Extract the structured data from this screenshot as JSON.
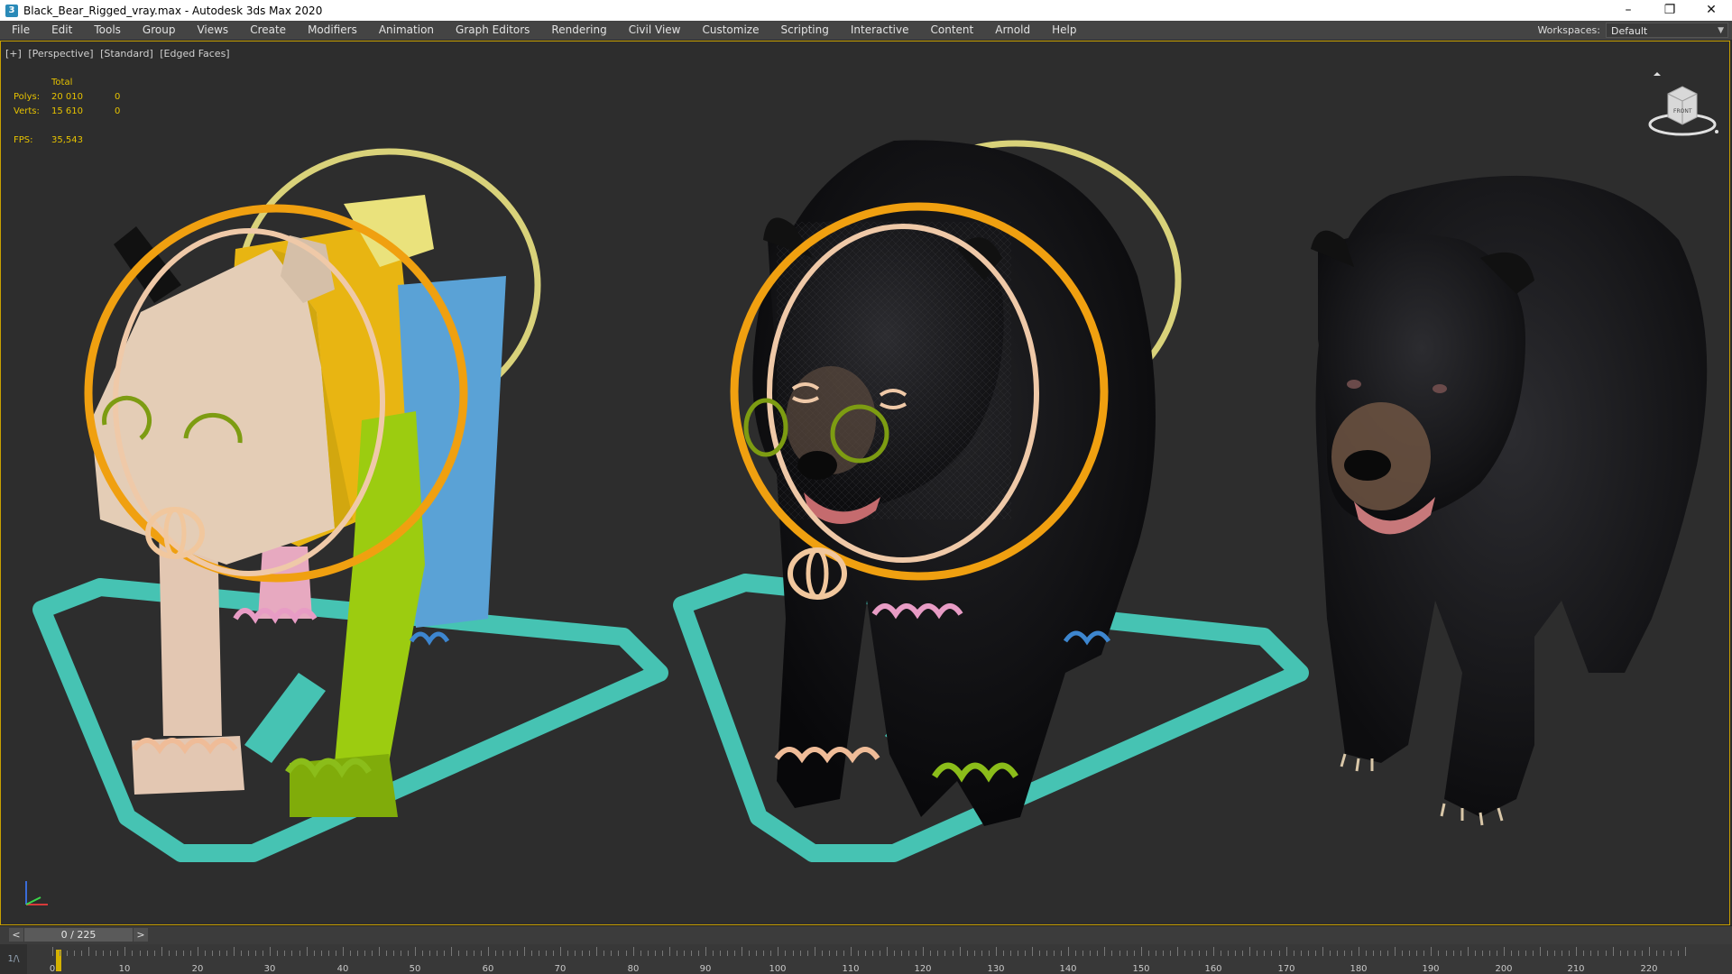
{
  "window": {
    "title": "Black_Bear_Rigged_vray.max - Autodesk 3ds Max 2020",
    "app_icon": "3",
    "buttons": {
      "minimize": "–",
      "restore": "❐",
      "close": "✕"
    }
  },
  "menu": {
    "items": [
      "File",
      "Edit",
      "Tools",
      "Group",
      "Views",
      "Create",
      "Modifiers",
      "Animation",
      "Graph Editors",
      "Rendering",
      "Civil View",
      "Customize",
      "Scripting",
      "Interactive",
      "Content",
      "Arnold",
      "Help"
    ],
    "workspaces_label": "Workspaces:",
    "workspaces_value": "Default"
  },
  "viewport": {
    "labels": [
      "[+]",
      "[Perspective]",
      "[Standard]",
      "[Edged Faces]"
    ],
    "stats": {
      "header": "Total",
      "polys_label": "Polys:",
      "polys_value": "20 010",
      "polys_sel": "0",
      "verts_label": "Verts:",
      "verts_value": "15 610",
      "verts_sel": "0",
      "fps_label": "FPS:",
      "fps_value": "35,543"
    },
    "viewcube_face": "FRONT"
  },
  "timeline": {
    "prev": "<",
    "next": ">",
    "slider_text": "0 / 225",
    "ruler_labels": [
      "0",
      "10",
      "20",
      "30",
      "40",
      "50",
      "60",
      "70",
      "80",
      "90",
      "100",
      "110",
      "120",
      "130",
      "140",
      "150",
      "160",
      "170",
      "180",
      "190",
      "200",
      "210",
      "220"
    ],
    "track_icon": "1/\\"
  },
  "colors": {
    "menubar": "#444444",
    "viewport_border": "#c8a000",
    "stats_text": "#e6c200",
    "control_orange": "#f0a010",
    "control_cyan": "#4cc7b8"
  }
}
